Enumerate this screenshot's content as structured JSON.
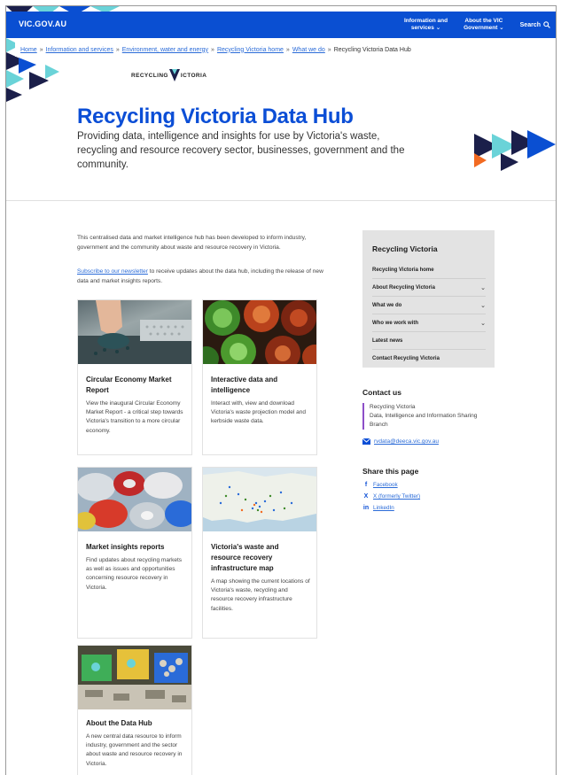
{
  "header": {
    "logo": "VIC.GOV.AU",
    "nav": [
      {
        "label": "Information and\nservices ⌄"
      },
      {
        "label": "About the VIC\nGovernment ⌄"
      }
    ],
    "search_label": "Search"
  },
  "breadcrumb": [
    "Home",
    "Information and services",
    "Environment, water and energy",
    "Recycling Victoria home",
    "What we do"
  ],
  "breadcrumb_current": "Recycling Victoria Data Hub",
  "brand": {
    "left": "RECYCLING ",
    "right": "ICTORIA"
  },
  "hero": {
    "title": "Recycling Victoria Data Hub",
    "text": "Providing data, intelligence and insights for use by Victoria's waste, recycling and resource recovery sector, businesses, government and the community."
  },
  "intro": {
    "p1": "This centralised data and market intelligence hub has been developed to inform industry, government and the community about waste and resource recovery in Victoria.",
    "link": "Subscribe to our newsletter",
    "p2_rest": " to receive updates about the data hub, including the release of new data and market insights reports."
  },
  "cards": [
    {
      "title": "Circular Economy Market Report",
      "desc": "View the inaugural Circular Economy Market Report - a critical step towards Victoria's transition to a more circular economy."
    },
    {
      "title": "Interactive data and intelligence",
      "desc": "Interact with, view and download Victoria's waste projection model and kerbside waste data."
    },
    {
      "title": "Market insights reports",
      "desc": "Find updates about recycling markets as well as issues and opportunities concerning resource recovery in Victoria."
    },
    {
      "title": "Victoria's waste and resource recovery infrastructure map",
      "desc": "A map showing the current locations of Victoria's waste, recycling and resource recovery infrastructure facilities."
    },
    {
      "title": "About the Data Hub",
      "desc": "A new central data resource to inform industry, government and the sector about waste and resource recovery in Victoria."
    }
  ],
  "sidenav": {
    "title": "Recycling Victoria",
    "items": [
      {
        "label": "Recycling Victoria home",
        "chev": ""
      },
      {
        "label": "About Recycling Victoria",
        "chev": "⌄"
      },
      {
        "label": "What we do",
        "chev": "⌄"
      },
      {
        "label": "Who we work with",
        "chev": "⌄"
      },
      {
        "label": "Latest news",
        "chev": ""
      },
      {
        "label": "Contact Recycling Victoria",
        "chev": ""
      }
    ]
  },
  "contact": {
    "heading": "Contact us",
    "line1": "Recycling Victoria",
    "line2": "Data, Intelligence and Information Sharing Branch",
    "email": "rvdata@deeca.vic.gov.au"
  },
  "share": {
    "heading": "Share this page",
    "items": [
      {
        "icon": "f",
        "label": "Facebook"
      },
      {
        "icon": "X",
        "label": "X (formerly Twitter)"
      },
      {
        "icon": "in",
        "label": "LinkedIn"
      }
    ]
  },
  "colors": {
    "primary": "#0b4ed6",
    "navy": "#1b1f4a",
    "teal": "#6ad3d8",
    "orange": "#f26a21",
    "link": "#2a6bd8"
  }
}
